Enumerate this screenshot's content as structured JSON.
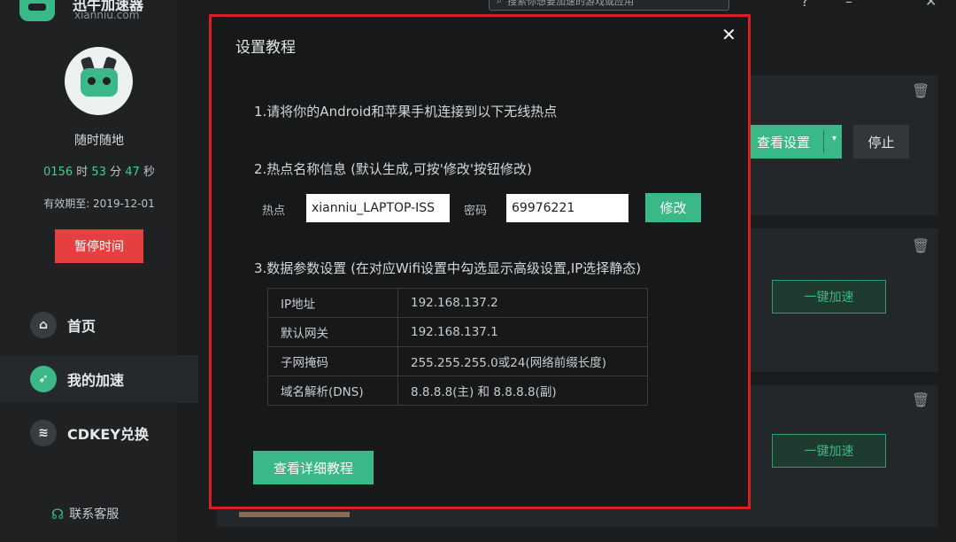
{
  "app": {
    "name": "迅牛加速器",
    "site": "xianniu.com"
  },
  "profile": {
    "motto": "随时随地",
    "timer": {
      "hours": "0156",
      "h_unit": "时",
      "minutes": "53",
      "m_unit": "分",
      "seconds": "47",
      "s_unit": "秒"
    },
    "expiry": "有效期至: 2019-12-01",
    "pause_label": "暂停时间"
  },
  "nav": {
    "items": [
      {
        "label": "首页",
        "icon": "home-icon"
      },
      {
        "label": "我的加速",
        "icon": "rocket-icon"
      },
      {
        "label": "CDKEY兑换",
        "icon": "layers-icon"
      }
    ],
    "support_label": "联系客服"
  },
  "topbar": {
    "search_placeholder": "搜索你想要加速的游戏或应用"
  },
  "cards": {
    "setting_label": "查看设置",
    "stop_label": "停止",
    "accel_label": "一键加速"
  },
  "modal": {
    "title": "设置教程",
    "close_icon": "close-icon",
    "step1": "1.请将你的Android和苹果手机连接到以下无线热点",
    "step2": "2.热点名称信息 (默认生成,可按'修改'按钮修改)",
    "hotspot_label": "热点",
    "hotspot_value": "xianniu_LAPTOP-ISS",
    "password_label": "密码",
    "password_value": "69976221",
    "modify_label": "修改",
    "step3": "3.数据参数设置 (在对应Wifi设置中勾选显示高级设置,IP选择静态)",
    "params": [
      {
        "key": "IP地址",
        "value": "192.168.137.2"
      },
      {
        "key": "默认网关",
        "value": "192.168.137.1"
      },
      {
        "key": "子网掩码",
        "value": "255.255.255.0或24(网络前缀长度)"
      },
      {
        "key": "域名解析(DNS)",
        "value": "8.8.8.8(主) 和 8.8.8.8(副)"
      }
    ],
    "detail_label": "查看详细教程"
  },
  "colors": {
    "accent": "#3ab887",
    "danger": "#e3403f",
    "highlight_border": "#d91f26",
    "background": "#1a1c1e"
  }
}
